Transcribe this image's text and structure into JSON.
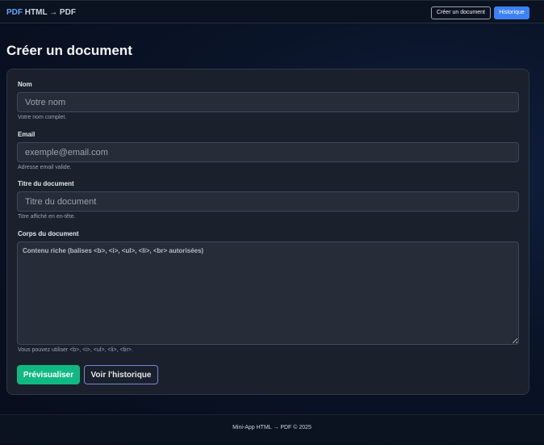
{
  "header": {
    "brand_accent": "PDF",
    "brand_rest": " HTML → PDF",
    "nav_create": "Créer un document",
    "nav_history": "Historique"
  },
  "page": {
    "title": "Créer un document"
  },
  "form": {
    "name": {
      "label": "Nom",
      "placeholder": "Votre nom",
      "help": "Votre nom complet."
    },
    "email": {
      "label": "Email",
      "placeholder": "exemple@email.com",
      "help": "Adresse email valide."
    },
    "doc_title": {
      "label": "Titre du document",
      "placeholder": "Titre du document",
      "help": "Titre affiché en en-tête."
    },
    "body": {
      "label": "Corps du document",
      "placeholder": "Contenu riche (balises <b>, <i>, <ul>, <li>, <br> autorisées)",
      "help": "Vous pouvez utiliser <b>, <i>, <ul>, <li>, <br>."
    },
    "preview_button": "Prévisualiser",
    "history_button": "Voir l'historique"
  },
  "footer": {
    "text": "Mini-App HTML → PDF © 2025"
  },
  "colors": {
    "accent_blue": "#3b82f6",
    "accent_green": "#10b981",
    "card_bg": "#1a212d"
  }
}
